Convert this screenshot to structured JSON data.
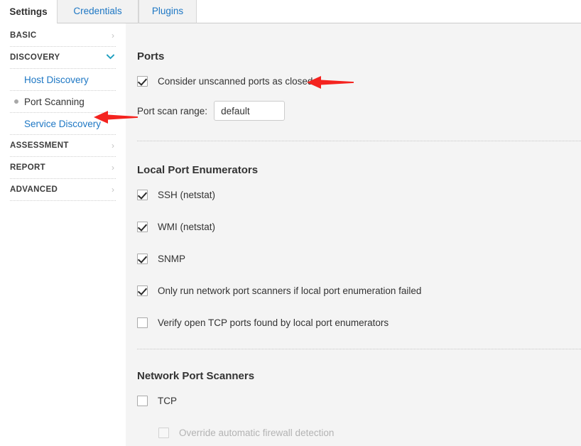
{
  "tabs": [
    {
      "label": "Settings",
      "active": true
    },
    {
      "label": "Credentials",
      "active": false
    },
    {
      "label": "Plugins",
      "active": false
    }
  ],
  "sidebar": {
    "items": [
      {
        "label": "BASIC",
        "type": "group",
        "chevron": "chevron-right-icon",
        "expanded": false
      },
      {
        "label": "DISCOVERY",
        "type": "group",
        "chevron": "chevron-down-icon",
        "expanded": true
      },
      {
        "label": "Host Discovery",
        "type": "sub",
        "active": false
      },
      {
        "label": "Port Scanning",
        "type": "sub",
        "active": true
      },
      {
        "label": "Service Discovery",
        "type": "sub",
        "active": false
      },
      {
        "label": "ASSESSMENT",
        "type": "group",
        "chevron": "chevron-right-icon",
        "expanded": false
      },
      {
        "label": "REPORT",
        "type": "group",
        "chevron": "chevron-right-icon",
        "expanded": false
      },
      {
        "label": "ADVANCED",
        "type": "group",
        "chevron": "chevron-right-icon",
        "expanded": false
      }
    ],
    "chevron_right_glyph": "›",
    "chevron_down_glyph": "⌄"
  },
  "main": {
    "ports": {
      "title": "Ports",
      "consider_unscanned": {
        "label": "Consider unscanned ports as closed",
        "checked": true
      },
      "scan_range": {
        "label": "Port scan range:",
        "value": "default",
        "placeholder": "default"
      }
    },
    "local_port_enumerators": {
      "title": "Local Port Enumerators",
      "items": [
        {
          "label": "SSH (netstat)",
          "checked": true,
          "disabled": false
        },
        {
          "label": "WMI (netstat)",
          "checked": true,
          "disabled": false
        },
        {
          "label": "SNMP",
          "checked": true,
          "disabled": false
        },
        {
          "label": "Only run network port scanners if local port enumeration failed",
          "checked": true,
          "disabled": false
        },
        {
          "label": "Verify open TCP ports found by local port enumerators",
          "checked": false,
          "disabled": false
        }
      ]
    },
    "network_port_scanners": {
      "title": "Network Port Scanners",
      "items": [
        {
          "label": "TCP",
          "checked": false,
          "disabled": false,
          "indent": false
        },
        {
          "label": "Override automatic firewall detection",
          "checked": false,
          "disabled": true,
          "indent": true
        }
      ]
    }
  },
  "annotations": {
    "color": "#f4231f",
    "arrows": [
      {
        "name": "arrow-consider-unscanned-ports",
        "points_to": "Consider unscanned ports as closed"
      },
      {
        "name": "arrow-port-scanning-nav",
        "points_to": "Port Scanning"
      }
    ]
  },
  "colors": {
    "accent_link": "#1d77c4",
    "content_bg": "#f4f4f4",
    "panel_bg": "#ffffff",
    "annotation_red": "#f4231f",
    "chevron_open": "#1f9fbf"
  }
}
